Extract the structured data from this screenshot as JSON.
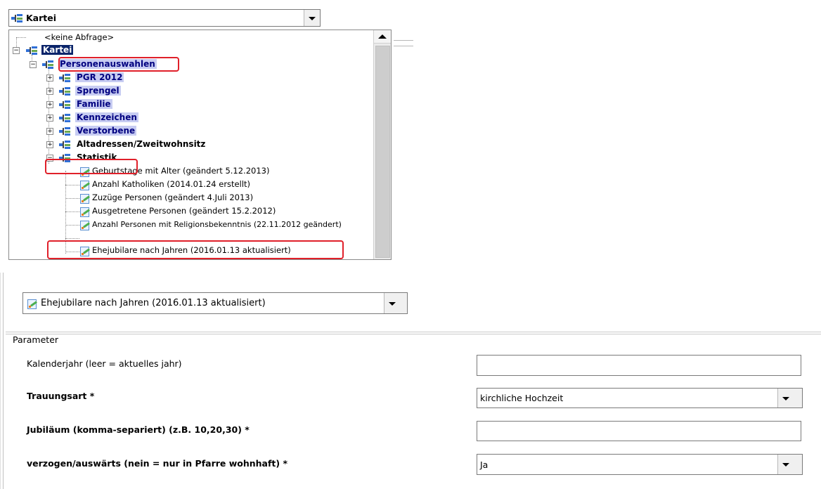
{
  "top_combo": {
    "value": "Kartei",
    "icon": "tree-query-icon"
  },
  "tree": {
    "items": [
      {
        "label": "<keine Abfrage>"
      },
      {
        "label": "Kartei"
      },
      {
        "label": "Personenauswahlen"
      },
      {
        "label": "PGR 2012"
      },
      {
        "label": "Sprengel"
      },
      {
        "label": "Familie"
      },
      {
        "label": "Kennzeichen"
      },
      {
        "label": "Verstorbene"
      },
      {
        "label": "Altadressen/Zweitwohnsitz"
      },
      {
        "label": "Statistik"
      },
      {
        "label": "Geburtstage mit Alter (geändert 5.12.2013)"
      },
      {
        "label": "Anzahl Katholiken (2014.01.24 erstellt)"
      },
      {
        "label": "Zuzüge Personen (geändert 4.Juli 2013)"
      },
      {
        "label": "Ausgetretene Personen (geändert 15.2.2012)"
      },
      {
        "label": "Anzahl Personen mit Religionsbekenntnis (22.11.2012 geändert)"
      },
      {
        "label": "Ehejubilare nach Jahren (2016.01.13 aktualisiert)"
      }
    ]
  },
  "query_combo": {
    "value": "Ehejubilare nach Jahren (2016.01.13 aktualisiert)",
    "icon": "query-edit-icon"
  },
  "parameter": {
    "group_title": "Parameter",
    "fields": [
      {
        "label": "Kalenderjahr (leer = aktuelles jahr)",
        "value": ""
      },
      {
        "label": "Trauungsart *",
        "value": "kirchliche Hochzeit"
      },
      {
        "label": "Jubiläum (komma-separiert) (z.B. 10,20,30) *",
        "value": ""
      },
      {
        "label": "verzogen/auswärts (nein = nur in Pfarre wohnhaft) *",
        "value": "Ja"
      }
    ]
  },
  "colors": {
    "highlight_box": "#e0202a",
    "selected_bg": "#0a246a",
    "group_bg": "#c7ccf2"
  }
}
